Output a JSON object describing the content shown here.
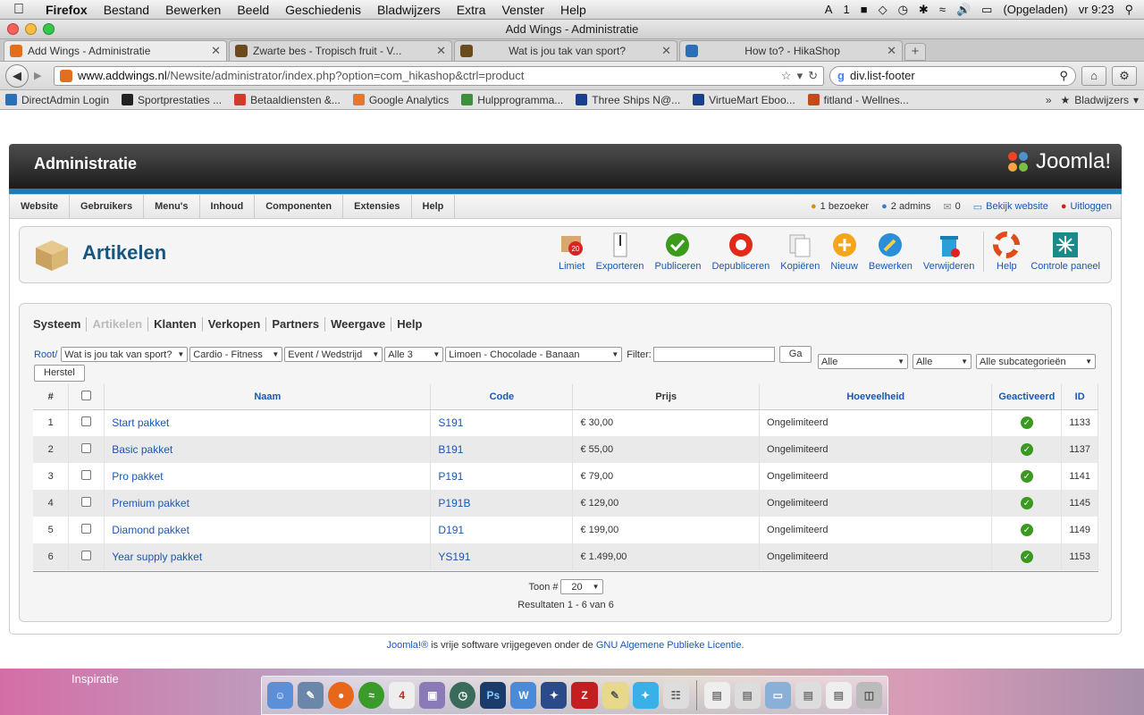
{
  "os_menubar": {
    "app": "Firefox",
    "items": [
      "Bestand",
      "Bewerken",
      "Beeld",
      "Geschiedenis",
      "Bladwijzers",
      "Extra",
      "Venster",
      "Help"
    ],
    "battery": "(Opgeladen)",
    "clock": "vr 9:23",
    "status_num": "1"
  },
  "window": {
    "title": "Add Wings - Administratie",
    "tabs": [
      {
        "title": "Add Wings - Administratie",
        "color": "#e07020"
      },
      {
        "title": "Zwarte bes - Tropisch fruit - V...",
        "color": "#6b4a1b"
      },
      {
        "title": "Wat is jou tak van sport?",
        "color": "#6b4a1b"
      },
      {
        "title": "How to? - HikaShop",
        "color": "#2a6fb7"
      }
    ],
    "url_host": "www.addwings.nl",
    "url_path": "/Newsite/administrator/index.php?option=com_hikashop&ctrl=product",
    "search_text": "div.list-footer",
    "bookmarks": [
      {
        "label": "DirectAdmin Login",
        "color": "#2a6fb7"
      },
      {
        "label": "Sportprestaties ...",
        "color": "#222"
      },
      {
        "label": "Betaaldiensten &...",
        "color": "#d03b2a"
      },
      {
        "label": "Google Analytics",
        "color": "#e8772e"
      },
      {
        "label": "Hulpprogramma...",
        "color": "#3f8f3f"
      },
      {
        "label": "Three Ships N@...",
        "color": "#1b3f8f"
      },
      {
        "label": "VirtueMart Eboo...",
        "color": "#1b3f8f"
      },
      {
        "label": "fitland - Wellnes...",
        "color": "#c24a1b"
      }
    ],
    "bookmarks_menu": "Bladwijzers"
  },
  "header": {
    "title": "Administratie",
    "logo_text": "Joomla!"
  },
  "main_menu": [
    "Website",
    "Gebruikers",
    "Menu's",
    "Inhoud",
    "Componenten",
    "Extensies",
    "Help"
  ],
  "status": {
    "visitors": "1 bezoeker",
    "admins": "2 admins",
    "messages": "0",
    "view_site": "Bekijk website",
    "logout": "Uitloggen"
  },
  "toolbar": {
    "page_title": "Artikelen",
    "buttons": [
      "Limiet",
      "Exporteren",
      "Publiceren",
      "Depubliceren",
      "Kopiëren",
      "Nieuw",
      "Bewerken",
      "Verwijderen",
      "Help",
      "Controle paneel"
    ],
    "limit_badge": "20"
  },
  "submenu": {
    "items": [
      "Systeem",
      "Artikelen",
      "Klanten",
      "Verkopen",
      "Partners",
      "Weergave",
      "Help"
    ]
  },
  "filters": {
    "root": "Root/",
    "selects": [
      "Wat is jou tak van sport?",
      "Cardio - Fitness",
      "Event / Wedstrijd",
      "Alle 3",
      "Limoen - Chocolade - Banaan"
    ],
    "filter_label": "Filter:",
    "filter_value": "",
    "go": "Ga",
    "reset": "Herstel",
    "right_selects": [
      "Alle",
      "Alle",
      "Alle subcategorieën"
    ]
  },
  "table": {
    "columns": [
      "#",
      "",
      "Naam",
      "Code",
      "Prijs",
      "Hoeveelheid",
      "Geactiveerd",
      "ID"
    ],
    "rows": [
      {
        "n": "1",
        "name": "Start pakket",
        "code": "S191",
        "price": "€ 30,00",
        "qty": "Ongelimiteerd",
        "id": "1133"
      },
      {
        "n": "2",
        "name": "Basic pakket",
        "code": "B191",
        "price": "€ 55,00",
        "qty": "Ongelimiteerd",
        "id": "1137"
      },
      {
        "n": "3",
        "name": "Pro pakket",
        "code": "P191",
        "price": "€ 79,00",
        "qty": "Ongelimiteerd",
        "id": "1141"
      },
      {
        "n": "4",
        "name": "Premium pakket",
        "code": "P191B",
        "price": "€ 129,00",
        "qty": "Ongelimiteerd",
        "id": "1145"
      },
      {
        "n": "5",
        "name": "Diamond pakket",
        "code": "D191",
        "price": "€ 199,00",
        "qty": "Ongelimiteerd",
        "id": "1149"
      },
      {
        "n": "6",
        "name": "Year supply pakket",
        "code": "YS191",
        "price": "€ 1.499,00",
        "qty": "Ongelimiteerd",
        "id": "1153"
      }
    ],
    "show_label": "Toon #",
    "show_value": "20",
    "results": "Resultaten 1 - 6 van 6"
  },
  "footer": {
    "joomla": "Joomla!®",
    "text": " is vrije software vrijgegeven onder de ",
    "license": "GNU Algemene Publieke Licentie",
    "end": "."
  },
  "desktop": {
    "label": "Inspiratie",
    "calendar_day": "4"
  }
}
